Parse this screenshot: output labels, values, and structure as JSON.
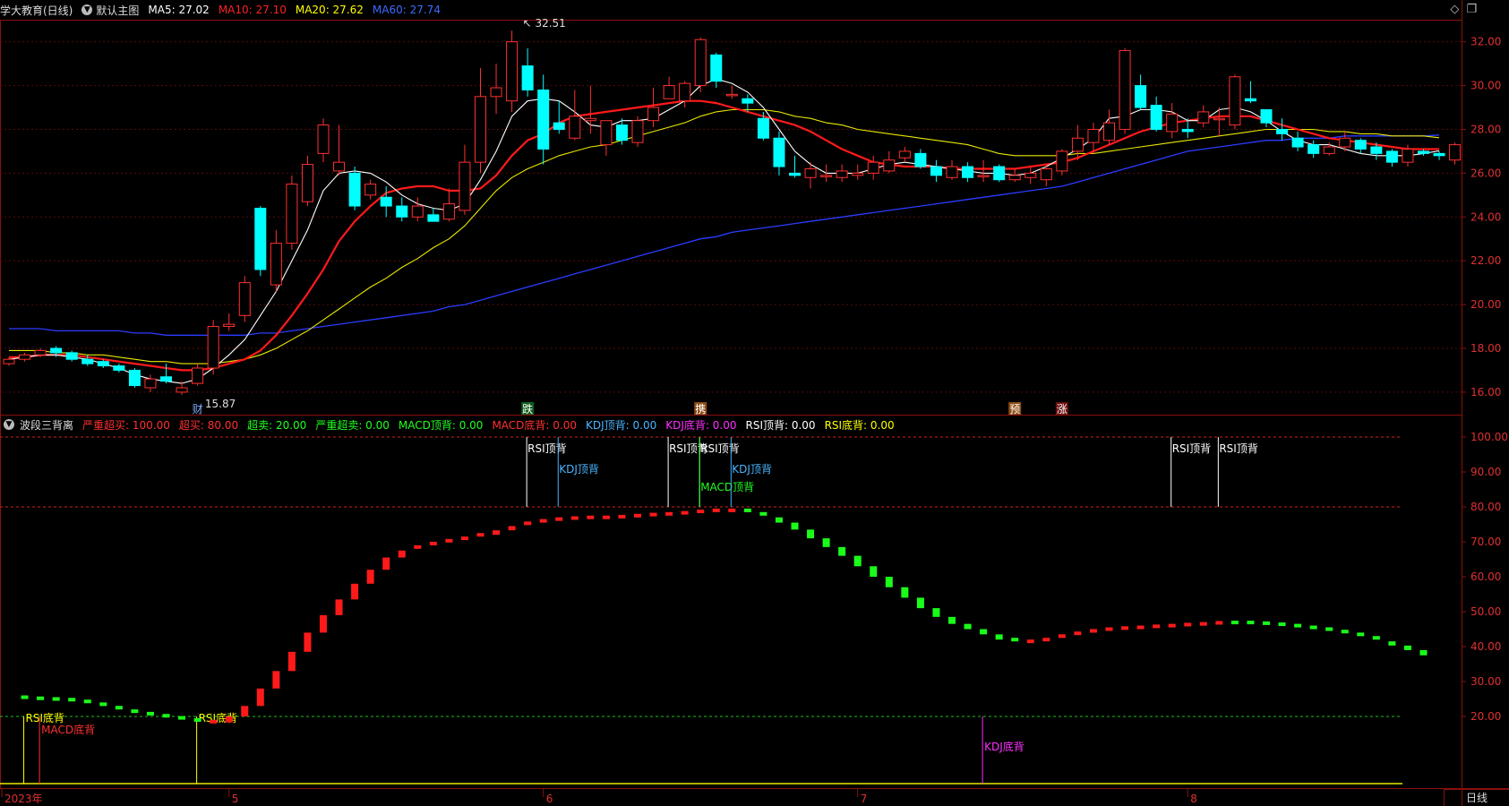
{
  "header": {
    "stock": "学大教育(日线)",
    "main_chart": "默认主图",
    "ma": [
      {
        "label": "MA5: 27.02",
        "color": "#ffffff"
      },
      {
        "label": "MA10: 27.10",
        "color": "#ff2020"
      },
      {
        "label": "MA20: 27.62",
        "color": "#ffff00"
      },
      {
        "label": "MA60: 27.74",
        "color": "#3d6bff"
      }
    ]
  },
  "window_controls": {
    "diamond": "◇",
    "restore": "❐"
  },
  "price_axis": {
    "ticks": [
      "32.00",
      "30.00",
      "28.00",
      "26.00",
      "24.00",
      "22.00",
      "20.00",
      "18.00",
      "16.00"
    ],
    "min": 15.3,
    "max": 32.6
  },
  "indicator": {
    "name": "波段三背离",
    "params": [
      {
        "label": "严重超买: 100.00",
        "color": "#ff3030"
      },
      {
        "label": "超买: 80.00",
        "color": "#ff3030"
      },
      {
        "label": "超卖: 20.00",
        "color": "#20ff20"
      },
      {
        "label": "严重超卖: 0.00",
        "color": "#20ff20"
      },
      {
        "label": "MACD顶背: 0.00",
        "color": "#20ff20"
      },
      {
        "label": "MACD底背: 0.00",
        "color": "#ff3030"
      },
      {
        "label": "KDJ顶背: 0.00",
        "color": "#4ab4ff"
      },
      {
        "label": "KDJ底背: 0.00",
        "color": "#ff30ff"
      },
      {
        "label": "RSI顶背: 0.00",
        "color": "#ffffff"
      },
      {
        "label": "RSI底背: 0.00",
        "color": "#ffff00"
      }
    ],
    "axis_ticks": [
      "100.00",
      "90.00",
      "80.00",
      "70.00",
      "60.00",
      "50.00",
      "40.00",
      "30.00",
      "20.00"
    ],
    "signals": [
      {
        "text": "RSI顶背",
        "type": "top",
        "color": "#ffffff",
        "idx": 33
      },
      {
        "text": "KDJ顶背",
        "type": "top",
        "color": "#4ab4ff",
        "idx": 35
      },
      {
        "text": "RSI顶背",
        "type": "top",
        "color": "#ffffff",
        "idx": 42
      },
      {
        "text": "RSI顶背",
        "type": "top",
        "color": "#ffffff",
        "idx": 44
      },
      {
        "text": "MACD顶背",
        "type": "top",
        "color": "#20ff20",
        "idx": 44
      },
      {
        "text": "KDJ顶背",
        "type": "top",
        "color": "#4ab4ff",
        "idx": 46
      },
      {
        "text": "RSI顶背",
        "type": "top",
        "color": "#ffffff",
        "idx": 74
      },
      {
        "text": "RSI顶背",
        "type": "top",
        "color": "#ffffff",
        "idx": 77
      },
      {
        "text": "RSI底背",
        "type": "bottom",
        "color": "#ffff00",
        "idx": 1
      },
      {
        "text": "MACD底背",
        "type": "bottom",
        "color": "#ff3030",
        "idx": 2
      },
      {
        "text": "RSI底背",
        "type": "bottom",
        "color": "#ffff00",
        "idx": 12
      },
      {
        "text": "KDJ底背",
        "type": "bottom",
        "color": "#ff30ff",
        "idx": 62
      }
    ]
  },
  "price_annotations": [
    {
      "text": "32.51",
      "idx": 32
    },
    {
      "text": "15.87",
      "idx": 11
    }
  ],
  "event_markers": [
    {
      "text": "财",
      "idx": 12,
      "bg": "#000000",
      "color": "#7fb0ff"
    },
    {
      "text": "跌",
      "idx": 33,
      "bg": "#0f5c1a",
      "color": "#ffffff"
    },
    {
      "text": "携",
      "idx": 44,
      "bg": "#8a4a10",
      "color": "#ffffff"
    },
    {
      "text": "预",
      "idx": 64,
      "bg": "#8a4a10",
      "color": "#ffffff"
    },
    {
      "text": "涨",
      "idx": 67,
      "bg": "#6b1010",
      "color": "#ffffff"
    }
  ],
  "date_axis": [
    {
      "text": "2023年",
      "idx": 0
    },
    {
      "text": "5",
      "idx": 14
    },
    {
      "text": "6",
      "idx": 34
    },
    {
      "text": "7",
      "idx": 54
    },
    {
      "text": "8",
      "idx": 75
    }
  ],
  "period_button": "日线",
  "chart_data": {
    "type": "candlestick",
    "candles": [
      [
        17.3,
        17.5,
        17.6,
        17.2
      ],
      [
        17.5,
        17.7,
        17.8,
        17.4
      ],
      [
        17.7,
        17.9,
        18.0,
        17.6
      ],
      [
        18.0,
        17.8,
        18.1,
        17.6
      ],
      [
        17.8,
        17.5,
        17.9,
        17.4
      ],
      [
        17.5,
        17.3,
        17.7,
        17.2
      ],
      [
        17.4,
        17.2,
        17.5,
        17.1
      ],
      [
        17.2,
        17.0,
        17.3,
        16.9
      ],
      [
        17.0,
        16.3,
        17.1,
        16.2
      ],
      [
        16.2,
        16.6,
        16.8,
        16.0
      ],
      [
        16.7,
        16.5,
        17.3,
        16.4
      ],
      [
        16.0,
        16.2,
        16.5,
        15.87
      ],
      [
        16.4,
        17.1,
        17.3,
        16.3
      ],
      [
        17.1,
        19.0,
        19.3,
        16.8
      ],
      [
        19.0,
        19.1,
        19.6,
        18.8
      ],
      [
        19.5,
        21.0,
        21.3,
        19.2
      ],
      [
        24.4,
        21.6,
        24.5,
        21.3
      ],
      [
        20.9,
        22.8,
        23.4,
        20.6
      ],
      [
        22.8,
        25.5,
        25.9,
        22.5
      ],
      [
        24.7,
        26.4,
        26.8,
        24.5
      ],
      [
        26.9,
        28.2,
        28.5,
        26.5
      ],
      [
        26.1,
        26.5,
        28.2,
        25.9
      ],
      [
        26.0,
        24.5,
        26.3,
        24.3
      ],
      [
        25.0,
        25.5,
        25.7,
        24.8
      ],
      [
        24.9,
        24.5,
        25.4,
        24.0
      ],
      [
        24.5,
        24.0,
        24.9,
        23.8
      ],
      [
        24.0,
        24.5,
        24.9,
        23.8
      ],
      [
        24.1,
        23.8,
        24.4,
        23.8
      ],
      [
        23.9,
        24.6,
        25.3,
        23.8
      ],
      [
        24.3,
        26.5,
        27.3,
        24.1
      ],
      [
        26.5,
        29.5,
        30.8,
        26.0
      ],
      [
        29.5,
        29.9,
        31.0,
        28.7
      ],
      [
        29.3,
        32.0,
        32.51,
        28.8
      ],
      [
        30.9,
        29.8,
        31.7,
        29.5
      ],
      [
        29.8,
        27.1,
        30.5,
        26.4
      ],
      [
        28.3,
        28.0,
        29.3,
        27.8
      ],
      [
        27.6,
        28.6,
        29.8,
        27.5
      ],
      [
        28.4,
        28.5,
        30.0,
        27.8
      ],
      [
        27.3,
        28.4,
        28.4,
        26.8
      ],
      [
        28.2,
        27.5,
        28.5,
        27.3
      ],
      [
        27.4,
        28.4,
        28.6,
        27.2
      ],
      [
        28.4,
        29.0,
        29.9,
        28.1
      ],
      [
        29.4,
        30.0,
        30.4,
        29.4
      ],
      [
        29.3,
        30.1,
        30.2,
        29.0
      ],
      [
        30.0,
        32.1,
        32.2,
        29.7
      ],
      [
        31.4,
        30.2,
        31.5,
        29.9
      ],
      [
        29.6,
        29.6,
        30.0,
        29.4
      ],
      [
        29.4,
        29.2,
        29.6,
        28.8
      ],
      [
        28.5,
        27.6,
        28.8,
        27.5
      ],
      [
        27.6,
        26.3,
        27.9,
        25.9
      ],
      [
        26.0,
        25.9,
        26.8,
        25.8
      ],
      [
        25.8,
        26.2,
        26.5,
        25.3
      ],
      [
        25.9,
        25.9,
        26.4,
        25.6
      ],
      [
        25.8,
        26.1,
        26.4,
        25.6
      ],
      [
        25.9,
        26.0,
        26.4,
        25.7
      ],
      [
        26.0,
        26.5,
        26.8,
        25.7
      ],
      [
        26.1,
        26.6,
        27.0,
        26.0
      ],
      [
        26.7,
        27.0,
        27.2,
        26.5
      ],
      [
        26.9,
        26.3,
        27.1,
        26.2
      ],
      [
        26.3,
        25.9,
        26.6,
        25.6
      ],
      [
        25.8,
        26.3,
        26.6,
        25.7
      ],
      [
        26.3,
        25.8,
        26.5,
        25.6
      ],
      [
        25.9,
        25.9,
        26.6,
        25.6
      ],
      [
        26.3,
        25.7,
        26.4,
        25.6
      ],
      [
        25.7,
        25.9,
        26.2,
        25.6
      ],
      [
        25.8,
        26.0,
        26.3,
        25.5
      ],
      [
        25.7,
        26.2,
        26.4,
        25.4
      ],
      [
        26.1,
        27.0,
        27.1,
        25.9
      ],
      [
        27.0,
        27.6,
        28.2,
        26.6
      ],
      [
        27.4,
        28.0,
        28.3,
        26.9
      ],
      [
        27.5,
        28.3,
        28.9,
        27.3
      ],
      [
        28.0,
        31.6,
        31.7,
        27.8
      ],
      [
        30.0,
        29.0,
        30.5,
        28.9
      ],
      [
        29.1,
        28.0,
        29.5,
        27.9
      ],
      [
        27.9,
        28.7,
        29.2,
        27.6
      ],
      [
        28.0,
        27.9,
        28.5,
        27.6
      ],
      [
        28.3,
        28.8,
        29.1,
        28.1
      ],
      [
        28.5,
        28.5,
        29.0,
        27.7
      ],
      [
        28.2,
        30.4,
        30.5,
        28.0
      ],
      [
        29.4,
        29.3,
        30.2,
        29.2
      ],
      [
        28.9,
        28.3,
        28.9,
        28.1
      ],
      [
        28.0,
        27.8,
        28.5,
        27.5
      ],
      [
        27.6,
        27.2,
        27.9,
        27.0
      ],
      [
        27.3,
        26.9,
        27.5,
        26.7
      ],
      [
        26.9,
        27.2,
        27.4,
        26.8
      ],
      [
        27.2,
        27.6,
        27.9,
        27.0
      ],
      [
        27.5,
        27.1,
        27.6,
        26.9
      ],
      [
        27.2,
        26.9,
        27.4,
        26.6
      ],
      [
        27.0,
        26.5,
        27.1,
        26.3
      ],
      [
        26.5,
        27.1,
        27.3,
        26.3
      ],
      [
        27.0,
        26.9,
        27.1,
        26.8
      ],
      [
        26.9,
        26.8,
        27.0,
        26.6
      ],
      [
        26.6,
        27.3,
        27.4,
        26.4
      ]
    ],
    "ma5": [
      17.5,
      17.6,
      17.7,
      17.7,
      17.6,
      17.5,
      17.3,
      17.1,
      16.8,
      16.6,
      16.5,
      16.4,
      16.6,
      17.1,
      17.7,
      18.4,
      19.5,
      20.6,
      22.0,
      23.4,
      25.2,
      26.0,
      26.1,
      26.0,
      25.6,
      25.0,
      24.6,
      24.4,
      24.3,
      24.6,
      25.7,
      27.0,
      28.6,
      29.3,
      29.4,
      29.3,
      28.8,
      28.2,
      28.1,
      28.4,
      28.4,
      28.5,
      28.9,
      29.3,
      30.0,
      30.3,
      30.1,
      29.7,
      29.0,
      28.0,
      27.0,
      26.4,
      26.0,
      26.0,
      26.0,
      26.2,
      26.4,
      26.5,
      26.4,
      26.3,
      26.2,
      26.1,
      26.0,
      26.0,
      25.9,
      26.0,
      26.3,
      26.7,
      27.1,
      27.6,
      28.5,
      28.6,
      28.9,
      28.9,
      28.8,
      28.4,
      28.4,
      28.9,
      29.0,
      28.8,
      28.4,
      27.9,
      27.5,
      27.3,
      27.3,
      27.1,
      26.9,
      26.8,
      26.8,
      26.8,
      26.9,
      27.02
    ],
    "ma10": [
      17.6,
      17.6,
      17.7,
      17.7,
      17.7,
      17.6,
      17.5,
      17.4,
      17.3,
      17.2,
      17.1,
      17.0,
      17.0,
      17.1,
      17.3,
      17.5,
      17.9,
      18.6,
      19.5,
      20.5,
      21.6,
      22.9,
      23.8,
      24.5,
      25.1,
      25.3,
      25.4,
      25.4,
      25.2,
      25.2,
      25.3,
      25.9,
      26.8,
      27.5,
      27.8,
      28.3,
      28.6,
      28.7,
      28.8,
      28.9,
      29.0,
      29.1,
      29.2,
      29.3,
      29.3,
      29.2,
      29.0,
      28.8,
      28.6,
      28.4,
      28.2,
      27.9,
      27.5,
      27.1,
      26.8,
      26.5,
      26.4,
      26.3,
      26.3,
      26.3,
      26.2,
      26.2,
      26.2,
      26.2,
      26.2,
      26.3,
      26.4,
      26.5,
      26.7,
      27.0,
      27.3,
      27.6,
      27.9,
      28.1,
      28.3,
      28.4,
      28.5,
      28.6,
      28.6,
      28.6,
      28.4,
      28.2,
      28.0,
      27.8,
      27.6,
      27.5,
      27.4,
      27.3,
      27.2,
      27.1,
      27.1,
      27.1
    ],
    "ma20": [
      17.9,
      17.9,
      17.9,
      17.8,
      17.8,
      17.7,
      17.7,
      17.6,
      17.5,
      17.4,
      17.4,
      17.3,
      17.3,
      17.3,
      17.4,
      17.5,
      17.7,
      18.0,
      18.4,
      18.8,
      19.3,
      19.8,
      20.3,
      20.8,
      21.2,
      21.7,
      22.1,
      22.6,
      23.0,
      23.6,
      24.4,
      25.2,
      25.8,
      26.2,
      26.5,
      26.8,
      27.0,
      27.2,
      27.3,
      27.5,
      27.7,
      27.9,
      28.1,
      28.3,
      28.6,
      28.8,
      28.9,
      28.9,
      28.9,
      28.8,
      28.6,
      28.5,
      28.3,
      28.2,
      28.0,
      27.9,
      27.8,
      27.7,
      27.6,
      27.5,
      27.4,
      27.3,
      27.1,
      26.9,
      26.8,
      26.8,
      26.8,
      26.8,
      26.9,
      26.9,
      27.0,
      27.1,
      27.2,
      27.3,
      27.4,
      27.5,
      27.6,
      27.7,
      27.8,
      27.9,
      28.0,
      28.0,
      28.0,
      28.0,
      27.9,
      27.9,
      27.8,
      27.8,
      27.7,
      27.7,
      27.7,
      27.62
    ],
    "ma60": [
      18.9,
      18.9,
      18.9,
      18.8,
      18.8,
      18.8,
      18.8,
      18.8,
      18.7,
      18.7,
      18.6,
      18.6,
      18.6,
      18.6,
      18.6,
      18.6,
      18.7,
      18.7,
      18.8,
      18.9,
      19.0,
      19.1,
      19.2,
      19.3,
      19.4,
      19.5,
      19.6,
      19.7,
      19.9,
      20.0,
      20.2,
      20.4,
      20.6,
      20.8,
      21.0,
      21.2,
      21.4,
      21.6,
      21.8,
      22.0,
      22.2,
      22.4,
      22.6,
      22.8,
      23.0,
      23.1,
      23.3,
      23.4,
      23.5,
      23.6,
      23.7,
      23.8,
      23.9,
      24.0,
      24.1,
      24.2,
      24.3,
      24.4,
      24.5,
      24.6,
      24.7,
      24.8,
      24.9,
      25.0,
      25.1,
      25.2,
      25.3,
      25.4,
      25.6,
      25.8,
      26.0,
      26.2,
      26.4,
      26.6,
      26.8,
      27.0,
      27.1,
      27.2,
      27.3,
      27.4,
      27.5,
      27.5,
      27.6,
      27.6,
      27.6,
      27.7,
      27.7,
      27.7,
      27.7,
      27.7,
      27.7,
      27.74
    ],
    "wave": [
      25.5,
      25.2,
      25.0,
      24.8,
      24.3,
      23.5,
      22.5,
      21.5,
      20.8,
      20.2,
      19.6,
      19.0,
      18.5,
      18.3,
      20.0,
      23.0,
      28.0,
      33.0,
      38.5,
      44.0,
      49.0,
      53.5,
      58.0,
      62.0,
      65.5,
      67.5,
      68.5,
      69.5,
      70.3,
      71.0,
      72.0,
      73.3,
      74.5,
      75.3,
      76.0,
      76.5,
      76.8,
      77.0,
      77.0,
      77.2,
      77.5,
      77.8,
      78.0,
      78.3,
      78.7,
      79.0,
      79.0,
      78.0,
      77.0,
      75.5,
      73.5,
      71.0,
      68.5,
      66.0,
      63.0,
      60.0,
      57.0,
      54.0,
      51.0,
      48.5,
      46.5,
      45.0,
      43.5,
      42.0,
      41.0,
      41.5,
      42.0,
      43.0,
      43.8,
      44.5,
      45.0,
      45.3,
      45.5,
      45.8,
      46.0,
      46.3,
      46.5,
      46.8,
      46.9,
      46.7,
      46.4,
      46.0,
      45.5,
      45.0,
      44.3,
      43.5,
      42.5,
      41.5,
      40.3,
      39.0,
      37.5
    ],
    "wave_red": [
      false,
      false,
      false,
      false,
      false,
      false,
      false,
      false,
      false,
      false,
      false,
      false,
      false,
      true,
      true,
      true,
      true,
      true,
      true,
      true,
      true,
      true,
      true,
      true,
      true,
      true,
      true,
      true,
      true,
      true,
      true,
      true,
      true,
      true,
      true,
      true,
      true,
      true,
      true,
      true,
      true,
      true,
      true,
      true,
      true,
      true,
      true,
      false,
      false,
      false,
      false,
      false,
      false,
      false,
      false,
      false,
      false,
      false,
      false,
      false,
      false,
      false,
      false,
      false,
      false,
      true,
      true,
      true,
      true,
      true,
      true,
      true,
      true,
      true,
      true,
      true,
      true,
      true,
      false,
      false,
      false,
      false,
      false,
      false,
      false,
      false,
      false,
      false,
      false,
      false,
      false
    ]
  }
}
